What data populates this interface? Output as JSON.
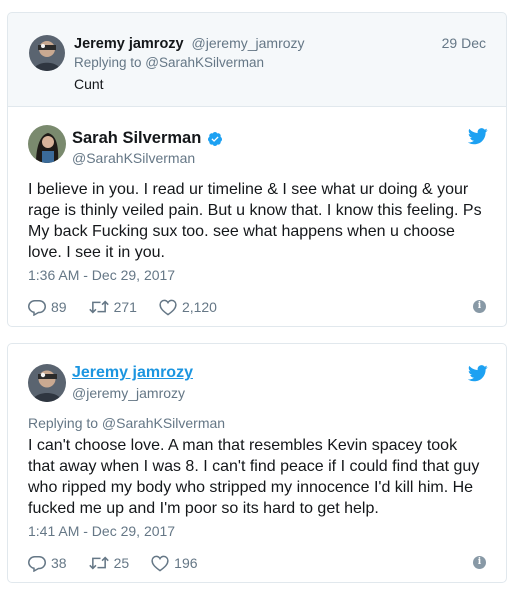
{
  "reply_tweet": {
    "name": "Jeremy jamrozy",
    "handle": "@jeremy_jamrozy",
    "date": "29 Dec",
    "replying_to": "Replying to @SarahKSilverman",
    "text": "Cunt"
  },
  "main_tweet": {
    "name": "Sarah Silverman",
    "handle": "@SarahKSilverman",
    "lines": [
      "I believe in you. I read ur timeline & I see what ur doing & your",
      "rage is thinly veiled pain. But u know that. I know this feeling. Ps",
      "My back Fucking sux too. see what happens when u choose",
      "love. I see it in you."
    ],
    "timestamp": "1:36 AM - Dec 29, 2017",
    "replies": "89",
    "retweets": "271",
    "likes": "2,120"
  },
  "second_tweet": {
    "name": "Jeremy jamrozy",
    "handle": "@jeremy_jamrozy",
    "replying_to": "Replying to @SarahKSilverman",
    "lines": [
      "I can't choose love. A man that resembles Kevin spacey took",
      "that away when I was 8. I can't find peace if I could find that guy",
      "who ripped my body who stripped my innocence I'd kill him. He",
      "fucked me up and I'm poor so its hard to get help."
    ],
    "timestamp": "1:41 AM - Dec 29, 2017",
    "replies": "38",
    "retweets": "25",
    "likes": "196"
  },
  "icons": {
    "twitter": "twitter-bird-icon",
    "verified": "verified-badge-icon",
    "reply": "reply-icon",
    "retweet": "retweet-icon",
    "like": "heart-icon",
    "info": "info-icon"
  },
  "colors": {
    "twitter_blue": "#1da1f2",
    "link_blue": "#1b95e0",
    "muted_text": "#657786",
    "border": "#e1e8ed",
    "reply_background": "#f5f8fa"
  }
}
